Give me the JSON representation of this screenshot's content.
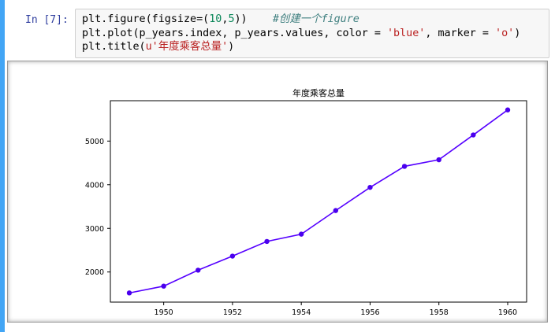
{
  "cell": {
    "prompt": "In [7]:",
    "code_lines": [
      [
        {
          "t": "plt.figure(figsize=(",
          "c": ""
        },
        {
          "t": "10",
          "c": "num"
        },
        {
          "t": ",",
          "c": ""
        },
        {
          "t": "5",
          "c": "num"
        },
        {
          "t": "))    ",
          "c": ""
        },
        {
          "t": "#创建一个figure",
          "c": "comment"
        }
      ],
      [
        {
          "t": "plt.plot(p_years.index, p_years.values, color = ",
          "c": ""
        },
        {
          "t": "'blue'",
          "c": "str"
        },
        {
          "t": ", marker = ",
          "c": ""
        },
        {
          "t": "'o'",
          "c": "str"
        },
        {
          "t": ")",
          "c": ""
        }
      ],
      [
        {
          "t": "plt.title(",
          "c": ""
        },
        {
          "t": "u'年度乘客总量'",
          "c": "str"
        },
        {
          "t": ")",
          "c": ""
        }
      ]
    ]
  },
  "colors": {
    "cell_bar": "#42a5f5",
    "line": "#5500ff",
    "marker": "#4a00ee",
    "axis": "#000000"
  },
  "chart_data": {
    "type": "line",
    "title": "年度乘客总量",
    "xlabel": "",
    "ylabel": "",
    "x": [
      1949,
      1950,
      1951,
      1952,
      1953,
      1954,
      1955,
      1956,
      1957,
      1958,
      1959,
      1960
    ],
    "series": [
      {
        "values": [
          1520,
          1676,
          2042,
          2364,
          2700,
          2867,
          3408,
          3939,
          4421,
          4572,
          5140,
          5714
        ]
      }
    ],
    "xlim": [
      1948.45,
      1960.55
    ],
    "ylim": [
      1310,
      5925
    ],
    "xticks": [
      1950,
      1952,
      1954,
      1956,
      1958,
      1960
    ],
    "yticks": [
      2000,
      3000,
      4000,
      5000
    ],
    "grid": false,
    "marker": "o"
  }
}
